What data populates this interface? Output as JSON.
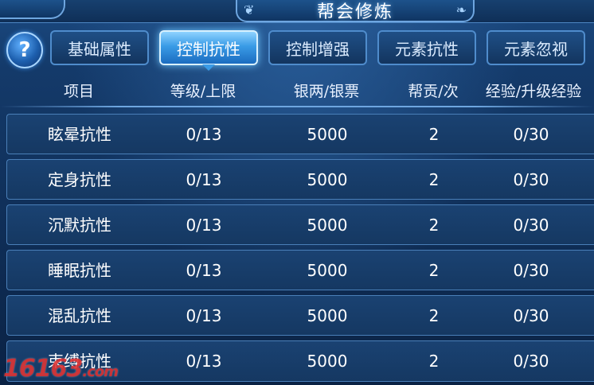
{
  "title": "帮会修炼",
  "help_icon_glyph": "?",
  "tabs": [
    {
      "label": "基础属性",
      "active": false
    },
    {
      "label": "控制抗性",
      "active": true
    },
    {
      "label": "控制增强",
      "active": false
    },
    {
      "label": "元素抗性",
      "active": false
    },
    {
      "label": "元素忽视",
      "active": false
    }
  ],
  "columns": [
    "项目",
    "等级/上限",
    "银两/银票",
    "帮贡/次",
    "经验/升级经验"
  ],
  "rows": [
    {
      "name": "眩晕抗性",
      "level": "0/13",
      "silver": "5000",
      "contribution": "2",
      "exp": "0/30"
    },
    {
      "name": "定身抗性",
      "level": "0/13",
      "silver": "5000",
      "contribution": "2",
      "exp": "0/30"
    },
    {
      "name": "沉默抗性",
      "level": "0/13",
      "silver": "5000",
      "contribution": "2",
      "exp": "0/30"
    },
    {
      "name": "睡眠抗性",
      "level": "0/13",
      "silver": "5000",
      "contribution": "2",
      "exp": "0/30"
    },
    {
      "name": "混乱抗性",
      "level": "0/13",
      "silver": "5000",
      "contribution": "2",
      "exp": "0/30"
    },
    {
      "name": "束缚抗性",
      "level": "0/13",
      "silver": "5000",
      "contribution": "2",
      "exp": "0/30"
    }
  ],
  "watermark": {
    "main": "16163",
    "suffix": ".com"
  },
  "colors": {
    "accent": "#3a9be6",
    "panel": "#153862",
    "border": "#4a7fb8",
    "watermark": "#dc2828"
  }
}
